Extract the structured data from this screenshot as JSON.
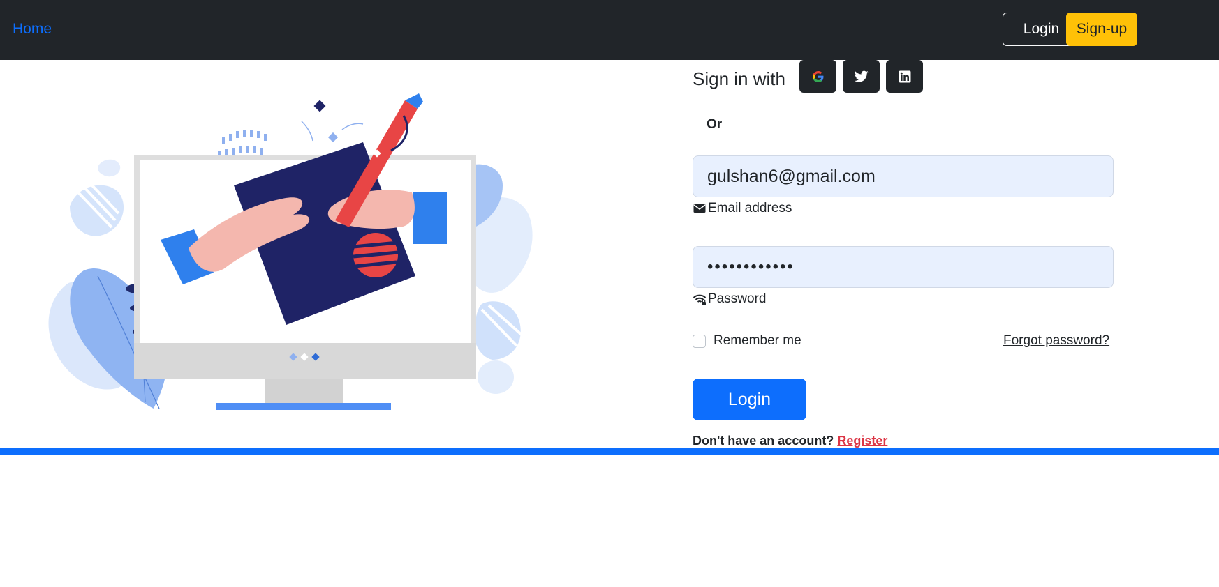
{
  "navbar": {
    "home_label": "Home",
    "login_label": "Login",
    "signup_label": "Sign-up"
  },
  "form": {
    "signin_with": "Sign in with",
    "social": [
      "google-icon",
      "twitter-icon",
      "linkedin-icon"
    ],
    "or": "Or",
    "email_value": "gulshan6@gmail.com",
    "email_label": "Email address",
    "password_value": "••••••••••••",
    "password_label": "Password",
    "remember_label": "Remember me",
    "remember_checked": false,
    "forgot_label": "Forgot password?",
    "login_button": "Login",
    "no_account": "Don't have an account?",
    "register_label": "Register"
  },
  "colors": {
    "navbar_bg": "#212529",
    "primary": "#0d6efd",
    "warning": "#ffc107",
    "danger": "#dc3545",
    "input_bg": "#e8f0fe"
  }
}
